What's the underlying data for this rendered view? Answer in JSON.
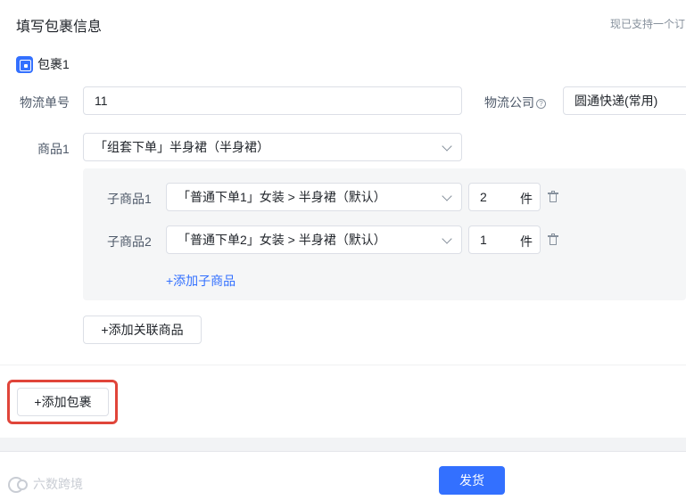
{
  "header": {
    "title": "填写包裹信息",
    "hint": "现已支持一个订"
  },
  "package": {
    "label": "包裹1",
    "tracking_label": "物流单号",
    "tracking_value": "11",
    "carrier_label": "物流公司",
    "carrier_value": "圆通快递(常用)",
    "product_label": "商品1",
    "product_value": "「组套下单」半身裙（半身裙）",
    "sub_products": [
      {
        "label": "子商品1",
        "value": "「普通下单1」女装 > 半身裙（默认）",
        "qty": "2",
        "unit": "件"
      },
      {
        "label": "子商品2",
        "value": "「普通下单2」女装 > 半身裙（默认）",
        "qty": "1",
        "unit": "件"
      }
    ],
    "add_sub_product": "+添加子商品",
    "add_related": "+添加关联商品"
  },
  "actions": {
    "add_package": "+添加包裹",
    "ship": "发货"
  },
  "watermark": "六数跨境",
  "colors": {
    "primary": "#3370ff",
    "highlight": "#e0453a"
  }
}
